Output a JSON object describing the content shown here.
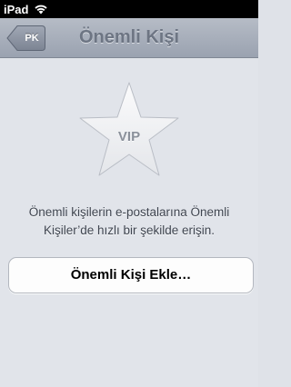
{
  "statusbar": {
    "carrier": "iPad",
    "wifi_icon": "wifi-icon"
  },
  "navbar": {
    "back_label": "PK",
    "title": "Önemli Kişi"
  },
  "main": {
    "vip_badge": "VIP",
    "description": "Önemli kişilerin e-postalarına Önemli Kişiler’de hızlı bir şekilde erişin.",
    "add_button_label": "Önemli Kişi Ekle…"
  },
  "colors": {
    "navbar_top": "#b6bcc6",
    "navbar_bottom": "#9aa2b0",
    "background": "#e1e4ea",
    "back_button": "#8b93a2"
  }
}
